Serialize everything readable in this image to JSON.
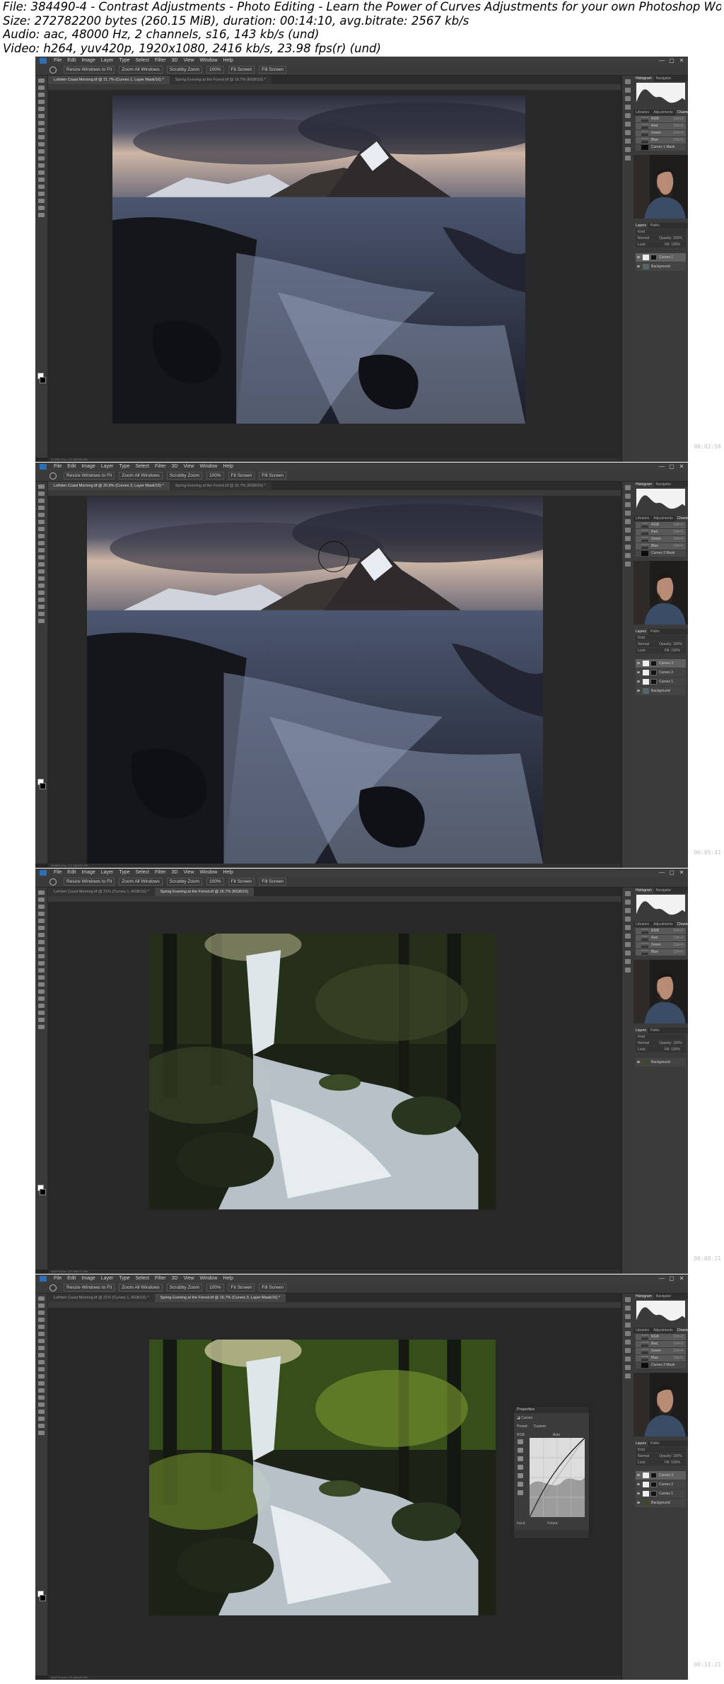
{
  "file_info": {
    "line1": "File: 384490-4 - Contrast Adjustments - Photo Editing - Learn the Power of Curves Adjustments for your own Photoshop Wo",
    "line2": "Size: 272782200 bytes (260.15 MiB), duration: 00:14:10, avg.bitrate: 2567 kb/s",
    "line3": "Audio: aac, 48000 Hz, 2 channels, s16, 143 kb/s (und)",
    "line4": "Video: h264, yuv420p, 1920x1080, 2416 kb/s, 23.98 fps(r) (und)"
  },
  "menu": [
    "File",
    "Edit",
    "Image",
    "Layer",
    "Type",
    "Select",
    "Filter",
    "3D",
    "View",
    "Window",
    "Help"
  ],
  "window_controls": [
    "—",
    "▢",
    "✕"
  ],
  "options_bar": [
    "Resize Windows to Fit",
    "Zoom All Windows",
    "Scrubby Zoom",
    "100%",
    "Fit Screen",
    "Fill Screen"
  ],
  "panel_tabs": {
    "top": [
      "Histogram",
      "Navigator"
    ],
    "middle": [
      "Libraries",
      "Adjustments",
      "Channels"
    ],
    "layers": [
      "Layers",
      "Paths"
    ]
  },
  "channels": [
    {
      "name": "RGB",
      "shortcut": "Ctrl+2"
    },
    {
      "name": "Red",
      "shortcut": "Ctrl+3"
    },
    {
      "name": "Green",
      "shortcut": "Ctrl+4"
    },
    {
      "name": "Blue",
      "shortcut": "Ctrl+5"
    }
  ],
  "layer_controls": {
    "kind": "Kind",
    "blend": "Normal",
    "opacity": "Opacity: 100%",
    "lock": "Lock:",
    "fill": "Fill: 100%"
  },
  "frames": [
    {
      "timestamp": "00:02:50",
      "tabs": [
        "Lofoten Coast Morning.tif @ 21.7% (Curves 1, Layer Mask/16) *",
        "Spring Evening at the Forest.tif @ 16.7% (RGB/16) *"
      ],
      "active_tab": 0,
      "status": "21.65%   Doc: 171.9M/351.8M",
      "photo": "seascape",
      "extra_channel": "Curves 1 Mask",
      "layers": [
        {
          "name": "Curves 1",
          "mask": true,
          "selected": true
        },
        {
          "name": "Background",
          "mask": false,
          "selected": false
        }
      ]
    },
    {
      "timestamp": "00:05:41",
      "tabs": [
        "Lofoten Coast Morning.tif @ 25.8% (Curves 3, Layer Mask/16) *",
        "Spring Evening at the Forest.tif @ 16.7% (RGB/16) *"
      ],
      "active_tab": 0,
      "status": "25.84%   Doc: 171.9M/401.2M",
      "photo": "seascape",
      "extra_channel": "Curves 3 Mask",
      "layers": [
        {
          "name": "Curves 3",
          "mask": true,
          "selected": true
        },
        {
          "name": "Curves 2",
          "mask": true,
          "selected": false
        },
        {
          "name": "Curves 1",
          "mask": true,
          "selected": false
        },
        {
          "name": "Background",
          "mask": false,
          "selected": false
        }
      ]
    },
    {
      "timestamp": "00:08:21",
      "tabs": [
        "Lofoten Coast Morning.tif @ 21% (Curves 1, RGB/16) *",
        "Spring Evening at the Forest.tif @ 16.7% (RGB/16)"
      ],
      "active_tab": 1,
      "status": "16.67%   Doc: 171.9M/171.9M",
      "photo": "waterfall",
      "extra_channel": "",
      "layers": [
        {
          "name": "Background",
          "mask": false,
          "selected": false
        }
      ]
    },
    {
      "timestamp": "00:11:21",
      "tabs": [
        "Lofoten Coast Morning.tif @ 21% (Curves 1, RGB/16) *",
        "Spring Evening at the Forest.tif @ 16.7% (Curves 3, Layer Mask/16) *"
      ],
      "active_tab": 1,
      "status": "16.67%   Doc: 171.9M/401.2M",
      "photo": "waterfall",
      "extra_channel": "Curves 3 Mask",
      "layers": [
        {
          "name": "Curves 3",
          "mask": true,
          "selected": true
        },
        {
          "name": "Curves 2",
          "mask": true,
          "selected": false
        },
        {
          "name": "Curves 1",
          "mask": true,
          "selected": false
        },
        {
          "name": "Background",
          "mask": false,
          "selected": false
        }
      ],
      "properties": {
        "title": "Properties",
        "kind": "Curves",
        "preset_label": "Preset:",
        "preset": "Custom",
        "channel": "RGB",
        "auto": "Auto",
        "input_label": "Input:",
        "output_label": "Output:"
      }
    }
  ]
}
